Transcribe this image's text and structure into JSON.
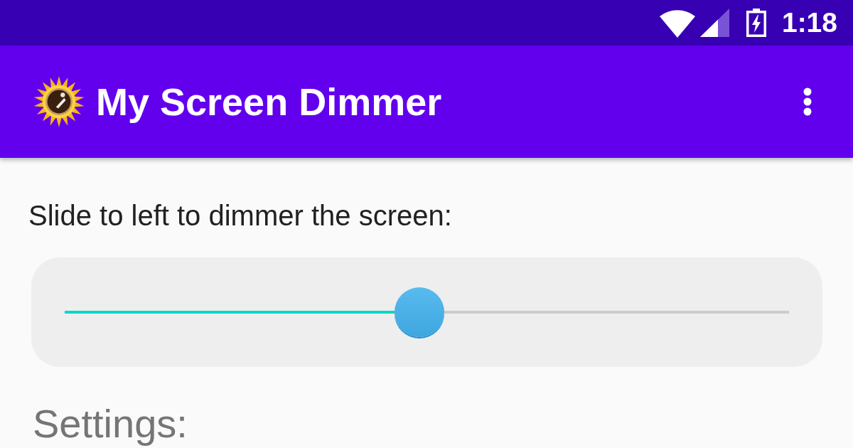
{
  "status_bar": {
    "time": "1:18"
  },
  "app_bar": {
    "title": "My Screen Dimmer"
  },
  "content": {
    "instruction": "Slide to left to dimmer the screen:",
    "slider": {
      "level": 0.49
    },
    "section_heading": "Settings:"
  }
}
